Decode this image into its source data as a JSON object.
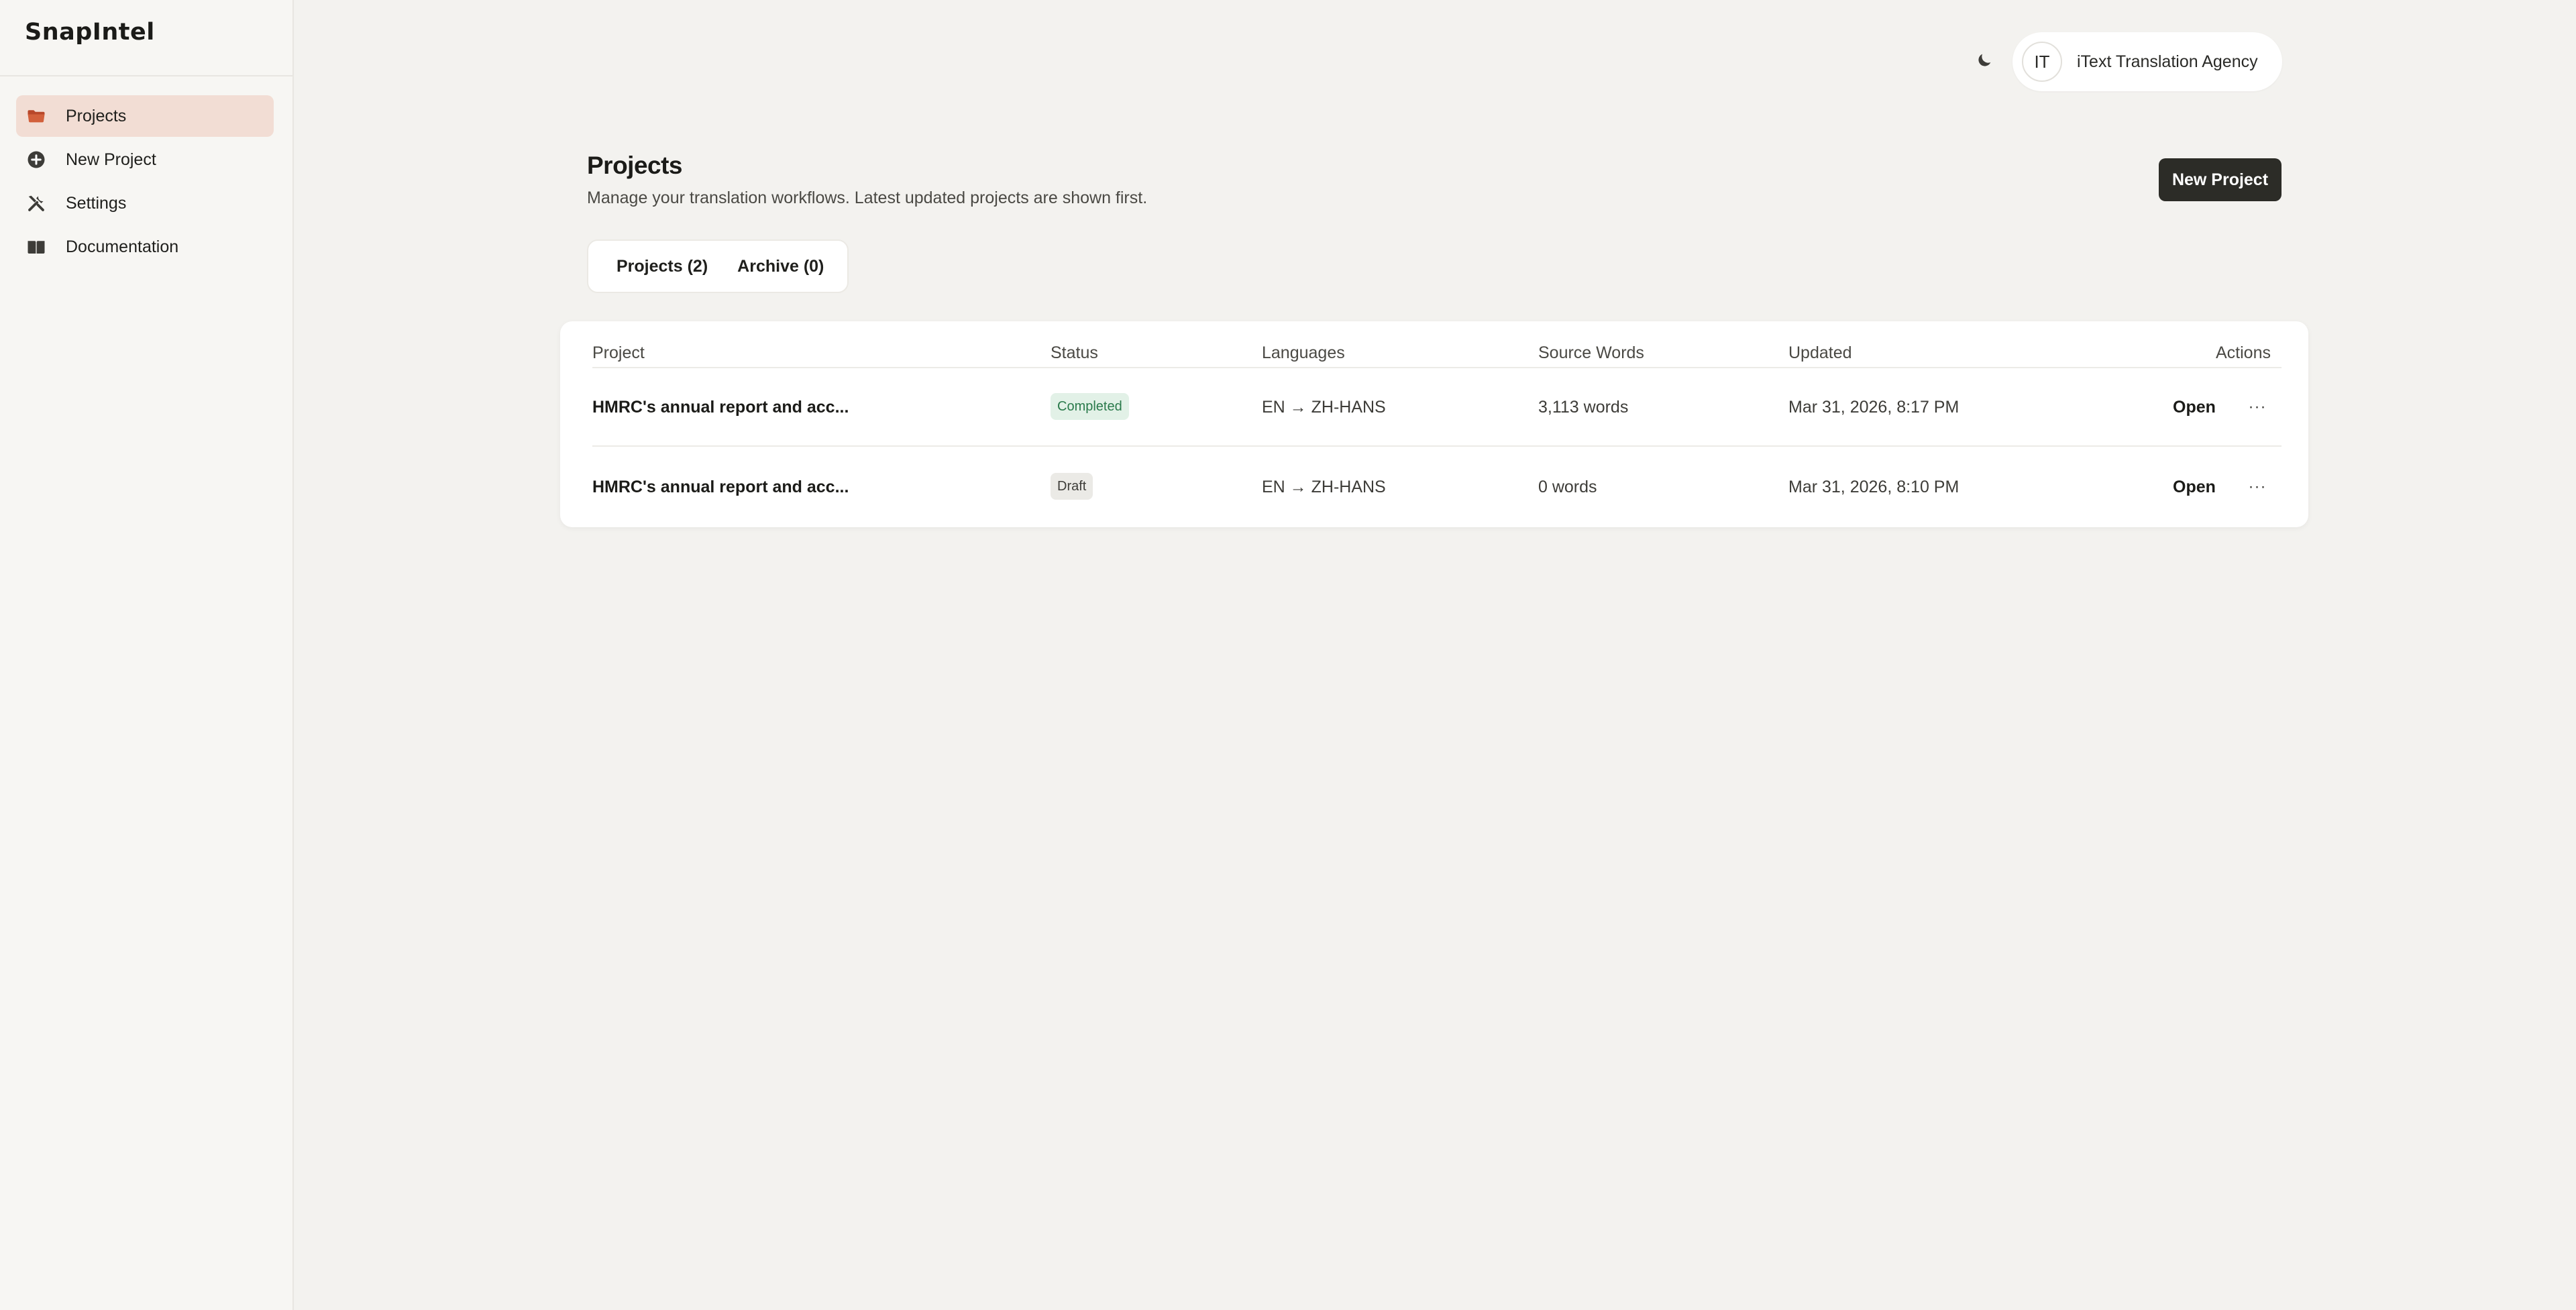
{
  "app": {
    "brand": "SnapIntel"
  },
  "sidebar": {
    "items": [
      {
        "label": "Projects",
        "icon": "folder-icon",
        "active": true
      },
      {
        "label": "New Project",
        "icon": "plus-circle-icon",
        "active": false
      },
      {
        "label": "Settings",
        "icon": "tools-icon",
        "active": false
      },
      {
        "label": "Documentation",
        "icon": "book-icon",
        "active": false
      }
    ]
  },
  "topbar": {
    "theme_icon": "moon-icon",
    "user": {
      "initials": "IT",
      "name": "iText Translation Agency"
    }
  },
  "header": {
    "title": "Projects",
    "subtitle": "Manage your translation workflows. Latest updated projects are shown first.",
    "new_project_label": "New Project"
  },
  "tabs": [
    {
      "label": "Projects (2)",
      "active": true
    },
    {
      "label": "Archive (0)",
      "active": false
    }
  ],
  "table": {
    "columns": {
      "project": "Project",
      "status": "Status",
      "languages": "Languages",
      "source_words": "Source Words",
      "updated": "Updated",
      "actions": "Actions"
    },
    "rows": [
      {
        "project": "HMRC's annual report and acc...",
        "status": "Completed",
        "languages": "EN → ZH-HANS",
        "source_words": "3,113 words",
        "updated": "Mar 31, 2026, 8:17 PM",
        "open_label": "Open",
        "more_label": "···"
      },
      {
        "project": "HMRC's annual report and acc...",
        "status": "Draft",
        "languages": "EN → ZH-HANS",
        "source_words": "0 words",
        "updated": "Mar 31, 2026, 8:10 PM",
        "open_label": "Open",
        "more_label": "···"
      }
    ]
  },
  "colors": {
    "accent": "#c8532f",
    "active_nav_bg": "#f2ddd4",
    "primary_button": "#2c2c27",
    "completed_badge_bg": "#e2f1e7",
    "completed_badge_text": "#2a7a4b"
  }
}
